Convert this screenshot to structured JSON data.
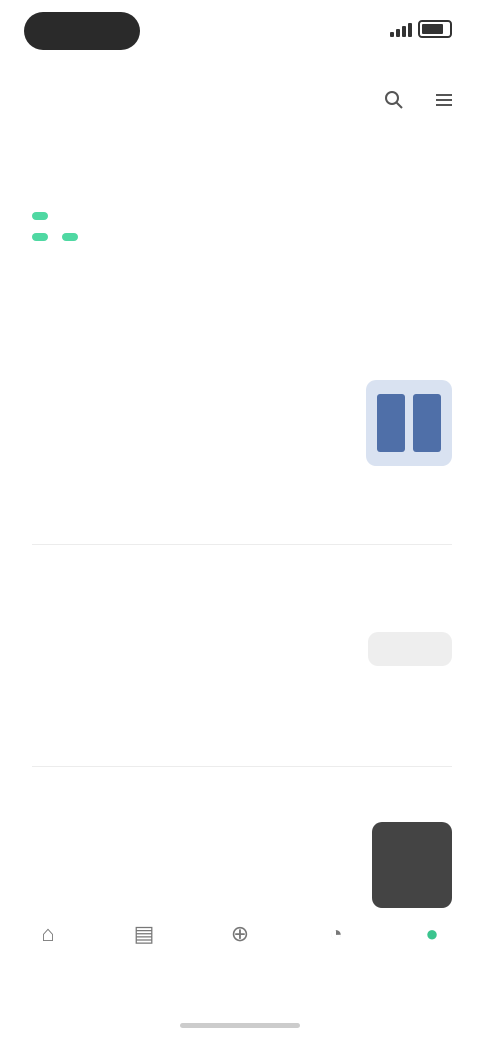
{
  "status": {
    "time": "",
    "battery_level": 0.7
  },
  "app_bar": {
    "title": ""
  },
  "section": {
    "label": ""
  },
  "hero": {
    "line1": "",
    "line2a": "",
    "line2b": ""
  },
  "articles": [
    {
      "meta": "",
      "title": "",
      "tag1": "",
      "tag2": ""
    },
    {
      "meta": "",
      "title": "",
      "tag1": "",
      "tag2": ""
    },
    {
      "meta": "",
      "title": "",
      "tag1": "",
      "tag2": ""
    }
  ],
  "nav": {
    "items": [
      {
        "icon": "home-icon",
        "label": ""
      },
      {
        "icon": "book-icon",
        "label": ""
      },
      {
        "icon": "add-icon",
        "label": ""
      },
      {
        "icon": "bell-icon",
        "label": ""
      },
      {
        "icon": "profile-icon",
        "label": ""
      }
    ]
  },
  "colors": {
    "accent": "#4fd8a2",
    "tag_green": "#3bc48e",
    "tag_red": "#ff6f61"
  }
}
